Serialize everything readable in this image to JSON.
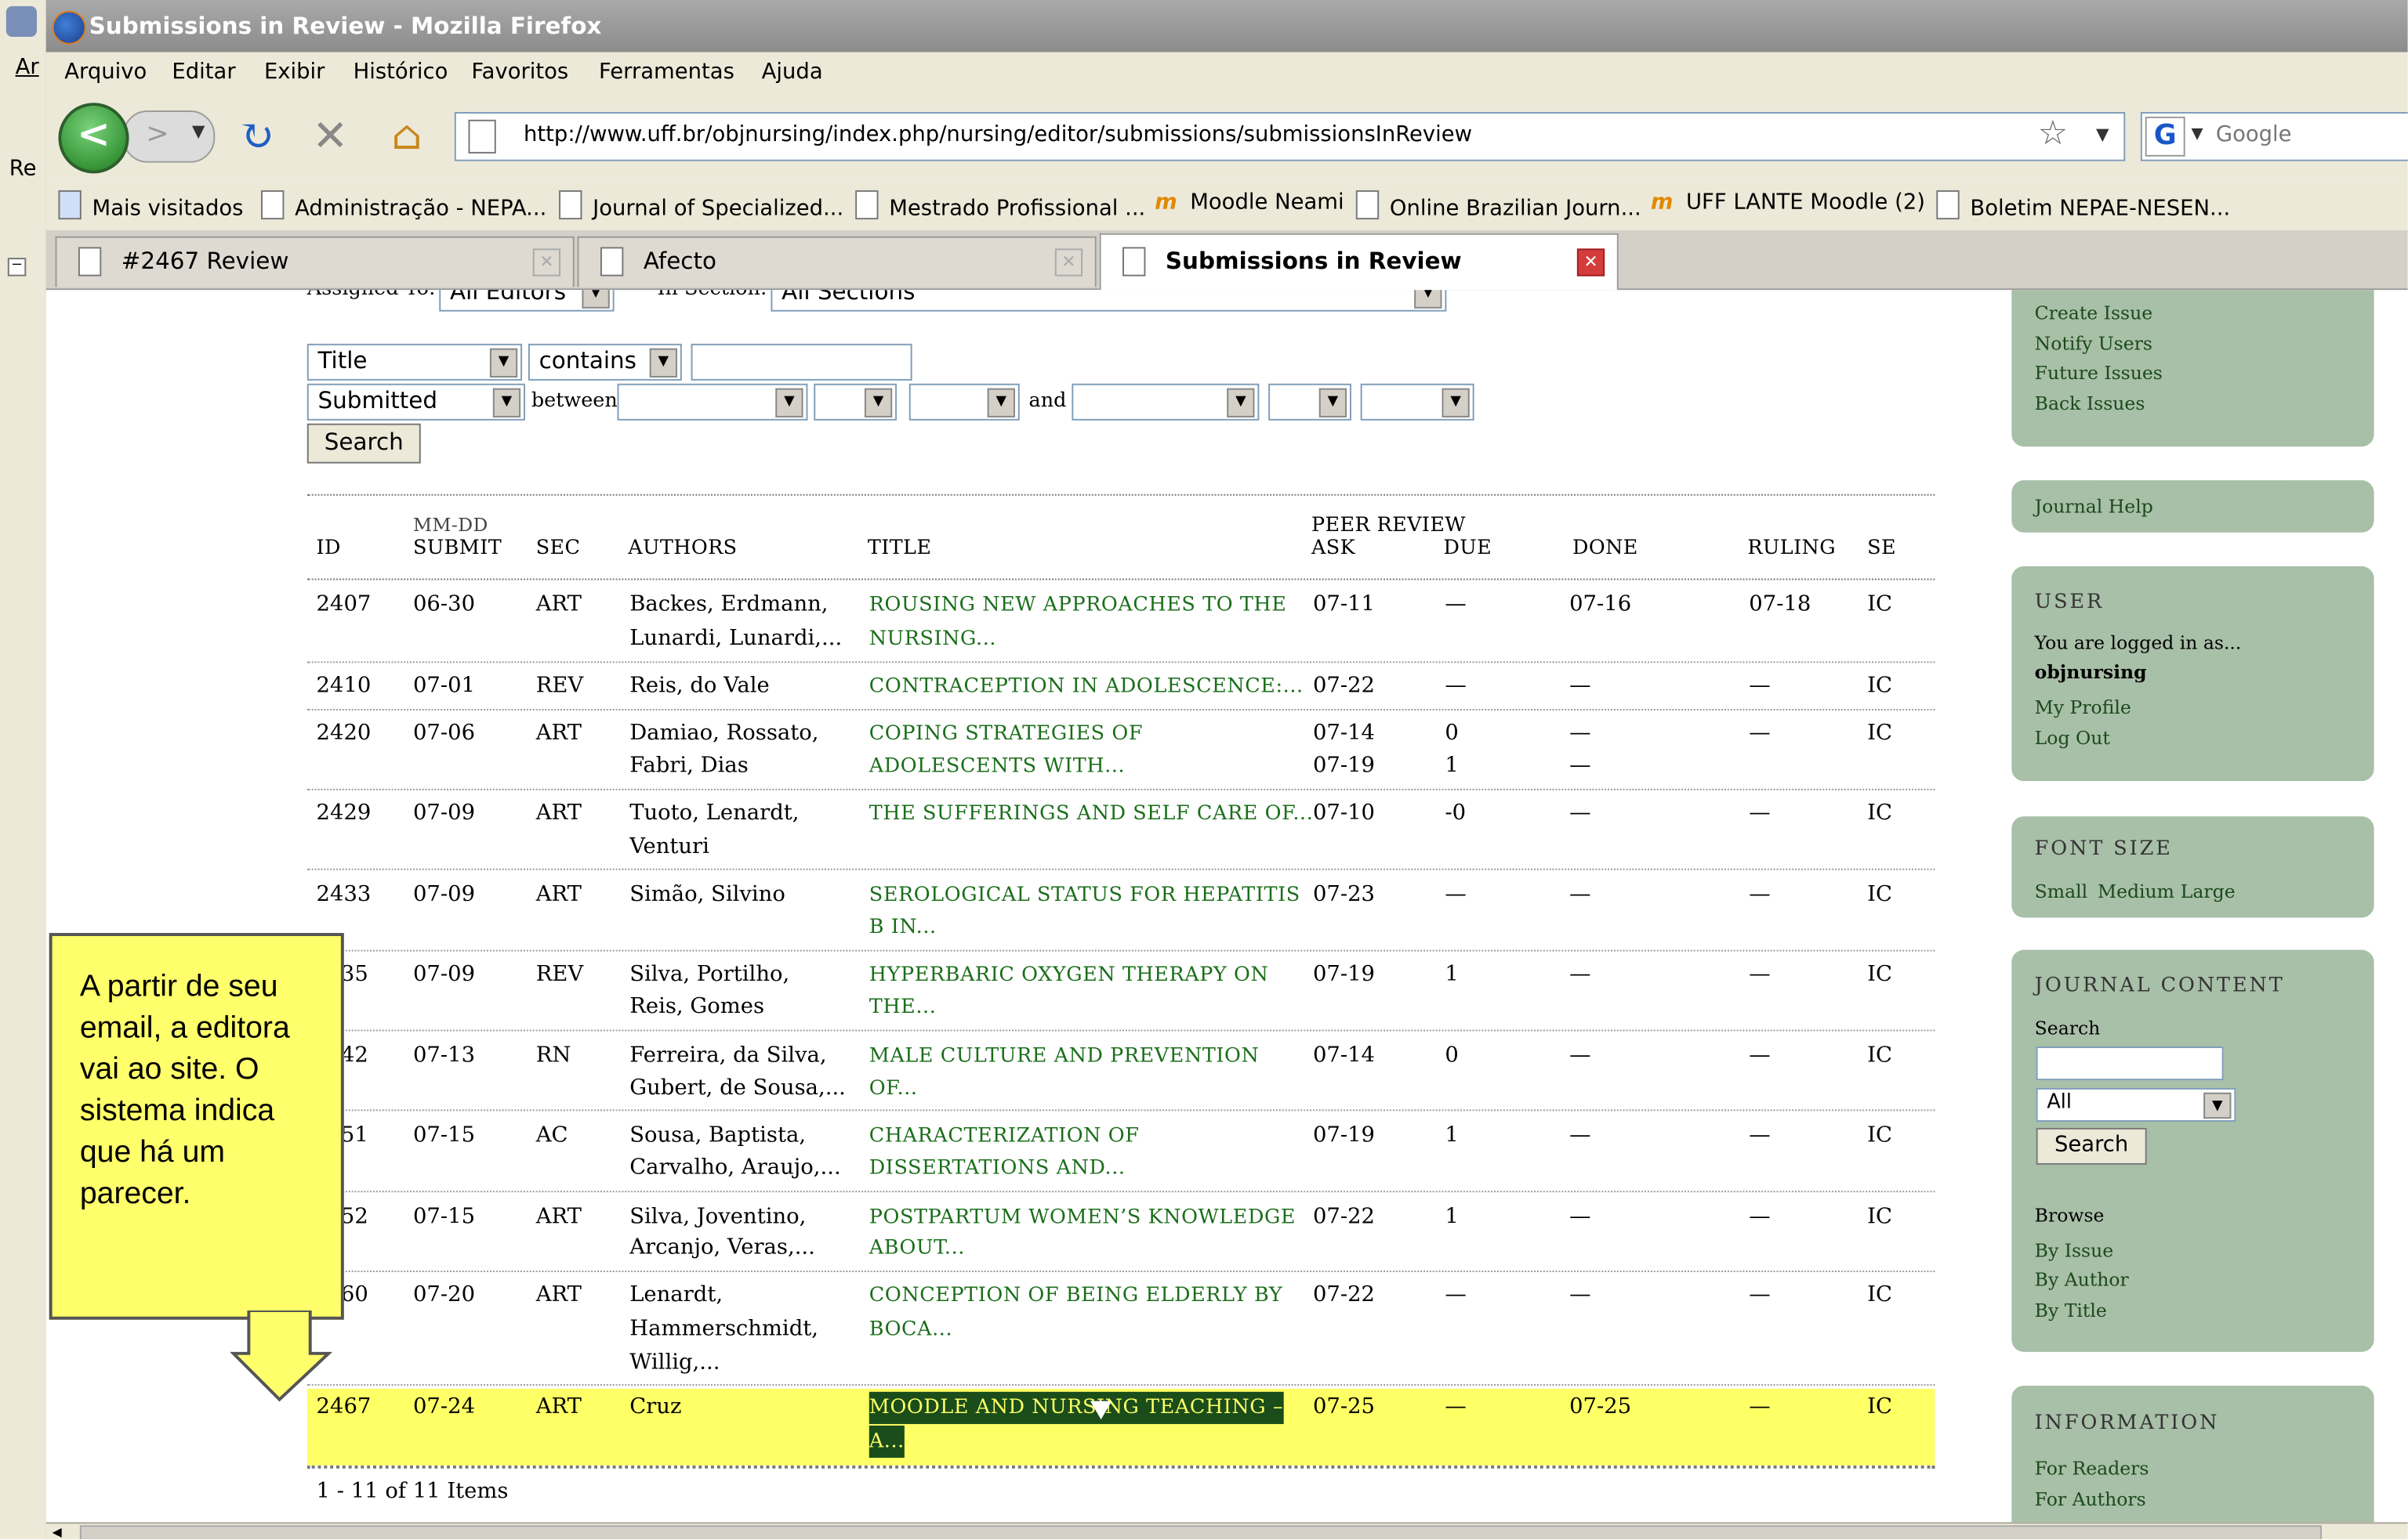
{
  "window": {
    "title": "Submissions in Review - Mozilla Firefox"
  },
  "menu": [
    "Arquivo",
    "Editar",
    "Exibir",
    "Histórico",
    "Favoritos",
    "Ferramentas",
    "Ajuda"
  ],
  "desktop": {
    "label_top": "Ar",
    "label_mid": "Re"
  },
  "address": {
    "url": "http://www.uff.br/objnursing/index.php/nursing/editor/submissions/submissionsInReview"
  },
  "search_engine": {
    "placeholder": "Google"
  },
  "bookmarks": [
    {
      "label": "Mais visitados",
      "icon": "folder-icon"
    },
    {
      "label": "Administração - NEPA...",
      "icon": "page-icon"
    },
    {
      "label": "Journal of Specialized...",
      "icon": "page-icon"
    },
    {
      "label": "Mestrado Profissional ...",
      "icon": "page-icon"
    },
    {
      "label": "Moodle Neami",
      "icon": "moodle-icon"
    },
    {
      "label": "Online Brazilian Journ...",
      "icon": "page-icon"
    },
    {
      "label": "UFF LANTE Moodle (2)",
      "icon": "moodle-icon"
    },
    {
      "label": "Boletim NEPAE-NESEN...",
      "icon": "page-icon"
    }
  ],
  "tabs": [
    {
      "label": "#2467 Review",
      "active": false
    },
    {
      "label": "Afecto",
      "active": false
    },
    {
      "label": "Submissions in Review",
      "active": true
    }
  ],
  "filters": {
    "assigned_to_label": "Assigned To:",
    "assigned_to_value": "All Editors",
    "in_section_label": "In Section:",
    "in_section_value": "All Sections",
    "field_value": "Title",
    "match_value": "contains",
    "search_text": "",
    "date_field_value": "Submitted",
    "between_label": "between",
    "and_label": "and",
    "search_button": "Search"
  },
  "table": {
    "headers": {
      "id": "ID",
      "submit_top": "MM-DD",
      "submit": "SUBMIT",
      "sec": "SEC",
      "authors": "AUTHORS",
      "title": "TITLE",
      "peer_review": "PEER REVIEW",
      "ask": "ASK",
      "due": "DUE",
      "done": "DONE",
      "ruling": "RULING",
      "se": "SE"
    },
    "rows": [
      {
        "id": "2407",
        "submit": "06-30",
        "sec": "ART",
        "authors1": "Backes, Erdmann,",
        "authors2": "Lunardi, Lunardi,...",
        "title1": "ROUSING NEW APPROACHES TO THE",
        "title2": "NURSING...",
        "ask1": "07-11",
        "ask2": "",
        "due1": "—",
        "due2": "",
        "done1": "07-16",
        "done2": "",
        "ruling": "07-18",
        "se": "IC"
      },
      {
        "id": "2410",
        "submit": "07-01",
        "sec": "REV",
        "authors1": "Reis, do Vale",
        "authors2": "",
        "title1": "CONTRACEPTION IN ADOLESCENCE:...",
        "title2": "",
        "ask1": "07-22",
        "ask2": "",
        "due1": "—",
        "due2": "",
        "done1": "—",
        "done2": "",
        "ruling": "—",
        "se": "IC"
      },
      {
        "id": "2420",
        "submit": "07-06",
        "sec": "ART",
        "authors1": "Damiao, Rossato,",
        "authors2": "Fabri, Dias",
        "title1": "COPING STRATEGIES OF",
        "title2": "ADOLESCENTS WITH...",
        "ask1": "07-14",
        "ask2": "07-19",
        "due1": "0",
        "due2": "1",
        "done1": "—",
        "done2": "—",
        "ruling": "—",
        "se": "IC"
      },
      {
        "id": "2429",
        "submit": "07-09",
        "sec": "ART",
        "authors1": "Tuoto, Lenardt,",
        "authors2": "Venturi",
        "title1": "THE SUFFERINGS AND SELF CARE OF...",
        "title2": "",
        "ask1": "07-10",
        "ask2": "",
        "due1": "-0",
        "due2": "",
        "done1": "—",
        "done2": "",
        "ruling": "—",
        "se": "IC"
      },
      {
        "id": "2433",
        "submit": "07-09",
        "sec": "ART",
        "authors1": "Simão, Silvino",
        "authors2": "",
        "title1": "SEROLOGICAL STATUS FOR HEPATITIS",
        "title2": "B IN...",
        "ask1": "07-23",
        "ask2": "",
        "due1": "—",
        "due2": "",
        "done1": "—",
        "done2": "",
        "ruling": "—",
        "se": "IC"
      },
      {
        "id": "35",
        "submit": "07-09",
        "sec": "REV",
        "authors1": "Silva, Portilho,",
        "authors2": "Reis, Gomes",
        "title1": "HYPERBARIC OXYGEN THERAPY ON",
        "title2": "THE...",
        "ask1": "07-19",
        "ask2": "",
        "due1": "1",
        "due2": "",
        "done1": "—",
        "done2": "",
        "ruling": "—",
        "se": "IC"
      },
      {
        "id": "42",
        "submit": "07-13",
        "sec": "RN",
        "authors1": "Ferreira, da Silva,",
        "authors2": "Gubert, de Sousa,...",
        "title1": "MALE CULTURE AND PREVENTION",
        "title2": "OF...",
        "ask1": "07-14",
        "ask2": "",
        "due1": "0",
        "due2": "",
        "done1": "—",
        "done2": "",
        "ruling": "—",
        "se": "IC"
      },
      {
        "id": "51",
        "submit": "07-15",
        "sec": "AC",
        "authors1": "Sousa, Baptista,",
        "authors2": "Carvalho, Araujo,...",
        "title1": "CHARACTERIZATION OF",
        "title2": "DISSERTATIONS AND...",
        "ask1": "07-19",
        "ask2": "",
        "due1": "1",
        "due2": "",
        "done1": "—",
        "done2": "",
        "ruling": "—",
        "se": "IC"
      },
      {
        "id": "52",
        "submit": "07-15",
        "sec": "ART",
        "authors1": "Silva, Joventino,",
        "authors2": "Arcanjo, Veras,...",
        "title1": "POSTPARTUM WOMEN’S KNOWLEDGE",
        "title2": "ABOUT...",
        "ask1": "07-22",
        "ask2": "",
        "due1": "1",
        "due2": "",
        "done1": "—",
        "done2": "",
        "ruling": "—",
        "se": "IC"
      },
      {
        "id": "60",
        "submit": "07-20",
        "sec": "ART",
        "authors1": "Lenardt,",
        "authors2": "Hammerschmidt,",
        "authors3": "Willig,...",
        "title1": "CONCEPTION OF BEING ELDERLY BY",
        "title2": "BOCA...",
        "ask1": "07-22",
        "ask2": "",
        "due1": "—",
        "due2": "",
        "done1": "—",
        "done2": "",
        "ruling": "—",
        "se": "IC"
      },
      {
        "id": "2467",
        "submit": "07-24",
        "sec": "ART",
        "authors1": "Cruz",
        "authors2": "",
        "title1": "MOODLE AND NURSING TEACHING –",
        "title2": "A...",
        "ask1": "07-25",
        "ask2": "",
        "due1": "—",
        "due2": "",
        "done1": "07-25",
        "done2": "",
        "ruling": "—",
        "se": "IC"
      }
    ],
    "footer": "1 - 11 of 11 Items"
  },
  "sidebar": {
    "issues_links": [
      "Create Issue",
      "Notify Users",
      "Future Issues",
      "Back Issues"
    ],
    "help_link": "Journal Help",
    "user": {
      "heading": "USER",
      "logged_text": "You are logged in as...",
      "username": "objnursing",
      "links": [
        "My Profile",
        "Log Out"
      ]
    },
    "font_size": {
      "heading": "FONT SIZE",
      "links": [
        "Small",
        "Medium",
        "Large"
      ]
    },
    "journal_content": {
      "heading": "JOURNAL CONTENT",
      "search_label": "Search",
      "scope_value": "All",
      "search_button": "Search",
      "browse_label": "Browse",
      "browse_links": [
        "By Issue",
        "By Author",
        "By Title"
      ]
    },
    "information": {
      "heading": "INFORMATION",
      "links": [
        "For Readers",
        "For Authors"
      ]
    }
  },
  "callout": {
    "text": "A partir de seu email, a editora vai ao site. O sistema indica que há um parecer."
  },
  "colors": {
    "highlight_row": "#ffff66",
    "link_green": "#1a6e1a",
    "sidebar_green": "#a8bfa8",
    "callout_yellow": "#ffff6b"
  }
}
